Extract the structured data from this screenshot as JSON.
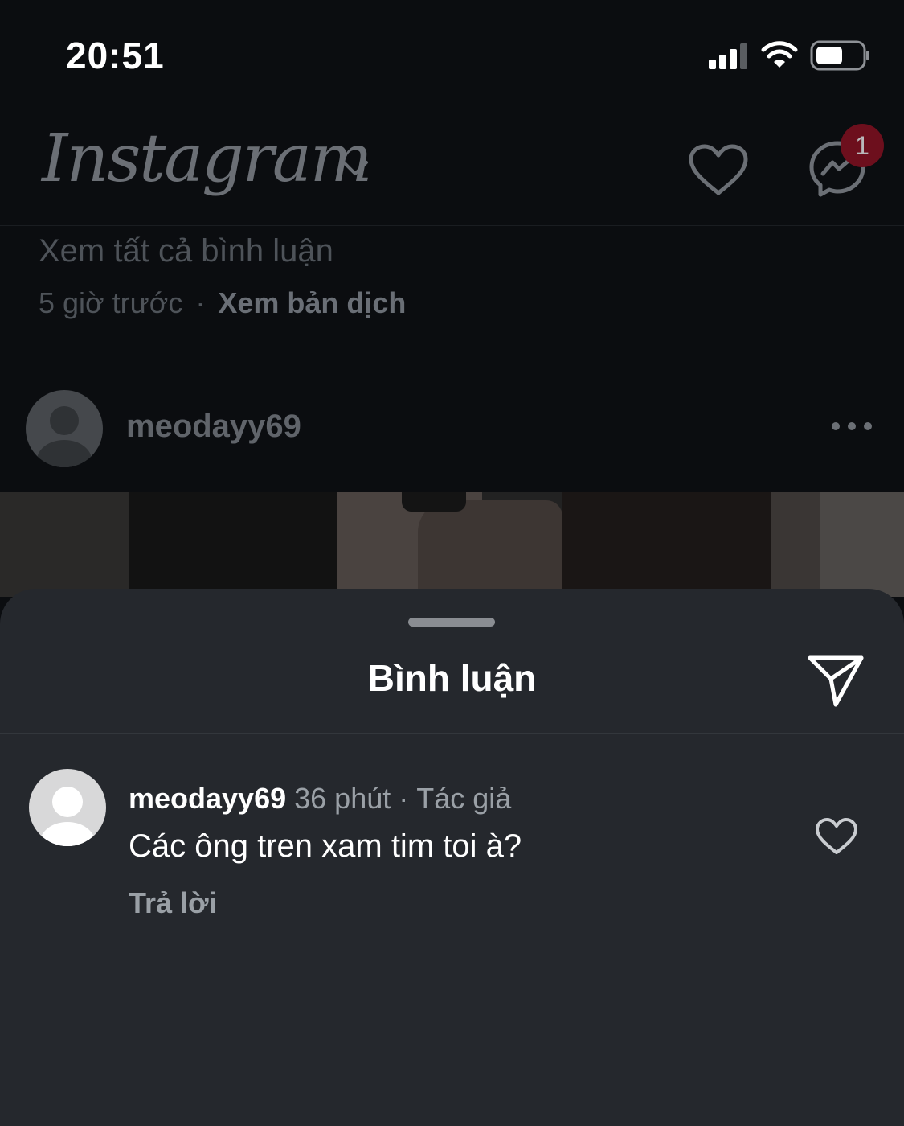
{
  "status_bar": {
    "time": "20:51"
  },
  "header": {
    "app_name": "Instagram",
    "messages_badge": "1"
  },
  "feed": {
    "see_all_comments": "Xem tất cả bình luận",
    "post_time": "5 giờ trước",
    "separator": "·",
    "translate": "Xem bản dịch",
    "post_username": "meodayy69"
  },
  "sheet": {
    "title": "Bình luận",
    "comments": [
      {
        "username": "meodayy69",
        "time": "36 phút",
        "separator": "·",
        "role": "Tác giả",
        "text": "Các ông tren xam tim toi à?",
        "reply_label": "Trả lời"
      }
    ]
  },
  "colors": {
    "background": "#0b0d10",
    "sheet": "#25282d",
    "badge": "#6d0f1d",
    "muted_text": "#9aa0a6"
  },
  "icons": [
    "signal-icon",
    "wifi-icon",
    "battery-icon",
    "chevron-down-icon",
    "heart-icon",
    "messenger-icon",
    "more-icon",
    "send-icon"
  ]
}
